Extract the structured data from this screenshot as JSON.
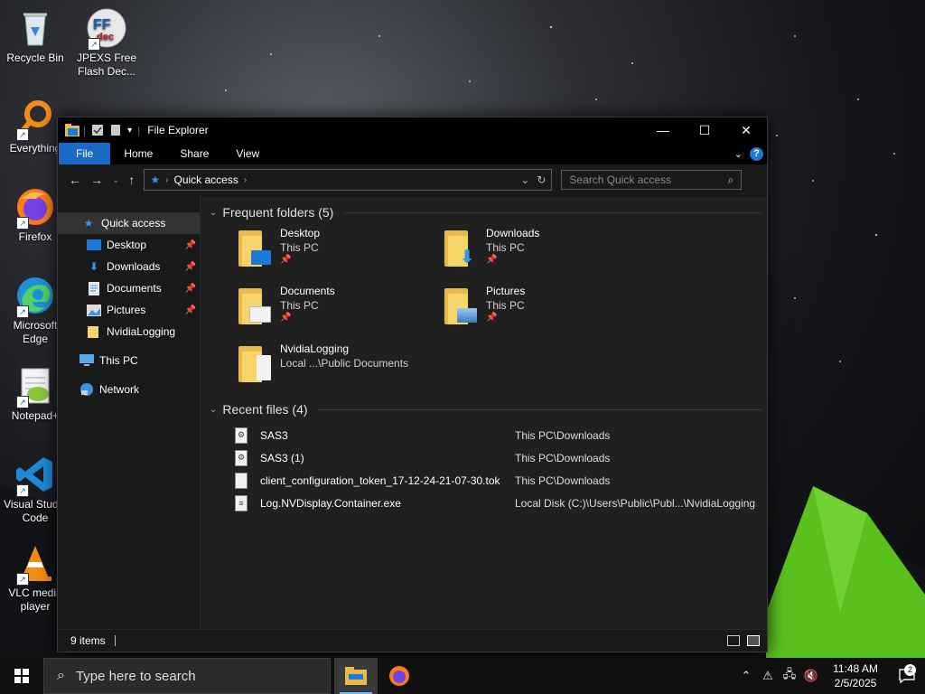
{
  "desktop": {
    "icons": [
      {
        "label": "Recycle Bin"
      },
      {
        "label": "JPEXS Free Flash Dec..."
      },
      {
        "label": "Everything"
      },
      {
        "label": "Firefox"
      },
      {
        "label": "Microsoft Edge"
      },
      {
        "label": "Notepad+"
      },
      {
        "label": "Visual Studio Code"
      },
      {
        "label": "VLC media player"
      }
    ]
  },
  "window": {
    "title": "File Explorer",
    "ribbon_tabs": [
      "File",
      "Home",
      "Share",
      "View"
    ],
    "address": {
      "crumb": "Quick access"
    },
    "search_placeholder": "Search Quick access",
    "sidebar": [
      {
        "label": "Quick access",
        "icon": "star-icon",
        "pinned": false
      },
      {
        "label": "Desktop",
        "icon": "desktop-folder-icon",
        "pinned": true
      },
      {
        "label": "Downloads",
        "icon": "download-arrow-icon",
        "pinned": true
      },
      {
        "label": "Documents",
        "icon": "documents-icon",
        "pinned": true
      },
      {
        "label": "Pictures",
        "icon": "pictures-icon",
        "pinned": true
      },
      {
        "label": "NvidiaLogging",
        "icon": "folder-icon",
        "pinned": false
      },
      {
        "label": "This PC",
        "icon": "computer-icon",
        "pinned": false
      },
      {
        "label": "Network",
        "icon": "network-icon",
        "pinned": false
      }
    ],
    "frequent": {
      "heading": "Frequent folders (5)",
      "items": [
        {
          "name": "Desktop",
          "location": "This PC"
        },
        {
          "name": "Downloads",
          "location": "This PC"
        },
        {
          "name": "Documents",
          "location": "This PC"
        },
        {
          "name": "Pictures",
          "location": "This PC"
        },
        {
          "name": "NvidiaLogging",
          "location": "Local ...\\Public Documents"
        }
      ]
    },
    "recent": {
      "heading": "Recent files (4)",
      "items": [
        {
          "name": "SAS3",
          "path": "This PC\\Downloads"
        },
        {
          "name": "SAS3 (1)",
          "path": "This PC\\Downloads"
        },
        {
          "name": "client_configuration_token_17-12-24-21-07-30.tok",
          "path": "This PC\\Downloads"
        },
        {
          "name": "Log.NVDisplay.Container.exe",
          "path": "Local Disk (C:)\\Users\\Public\\Publ...\\NvidiaLogging"
        }
      ]
    },
    "status": {
      "count": "9 items"
    }
  },
  "taskbar": {
    "search_placeholder": "Type here to search",
    "time": "11:48 AM",
    "date": "2/5/2025",
    "notifications": "2"
  },
  "colors": {
    "accent": "#1a6ac6",
    "folder": "#f5d469"
  }
}
